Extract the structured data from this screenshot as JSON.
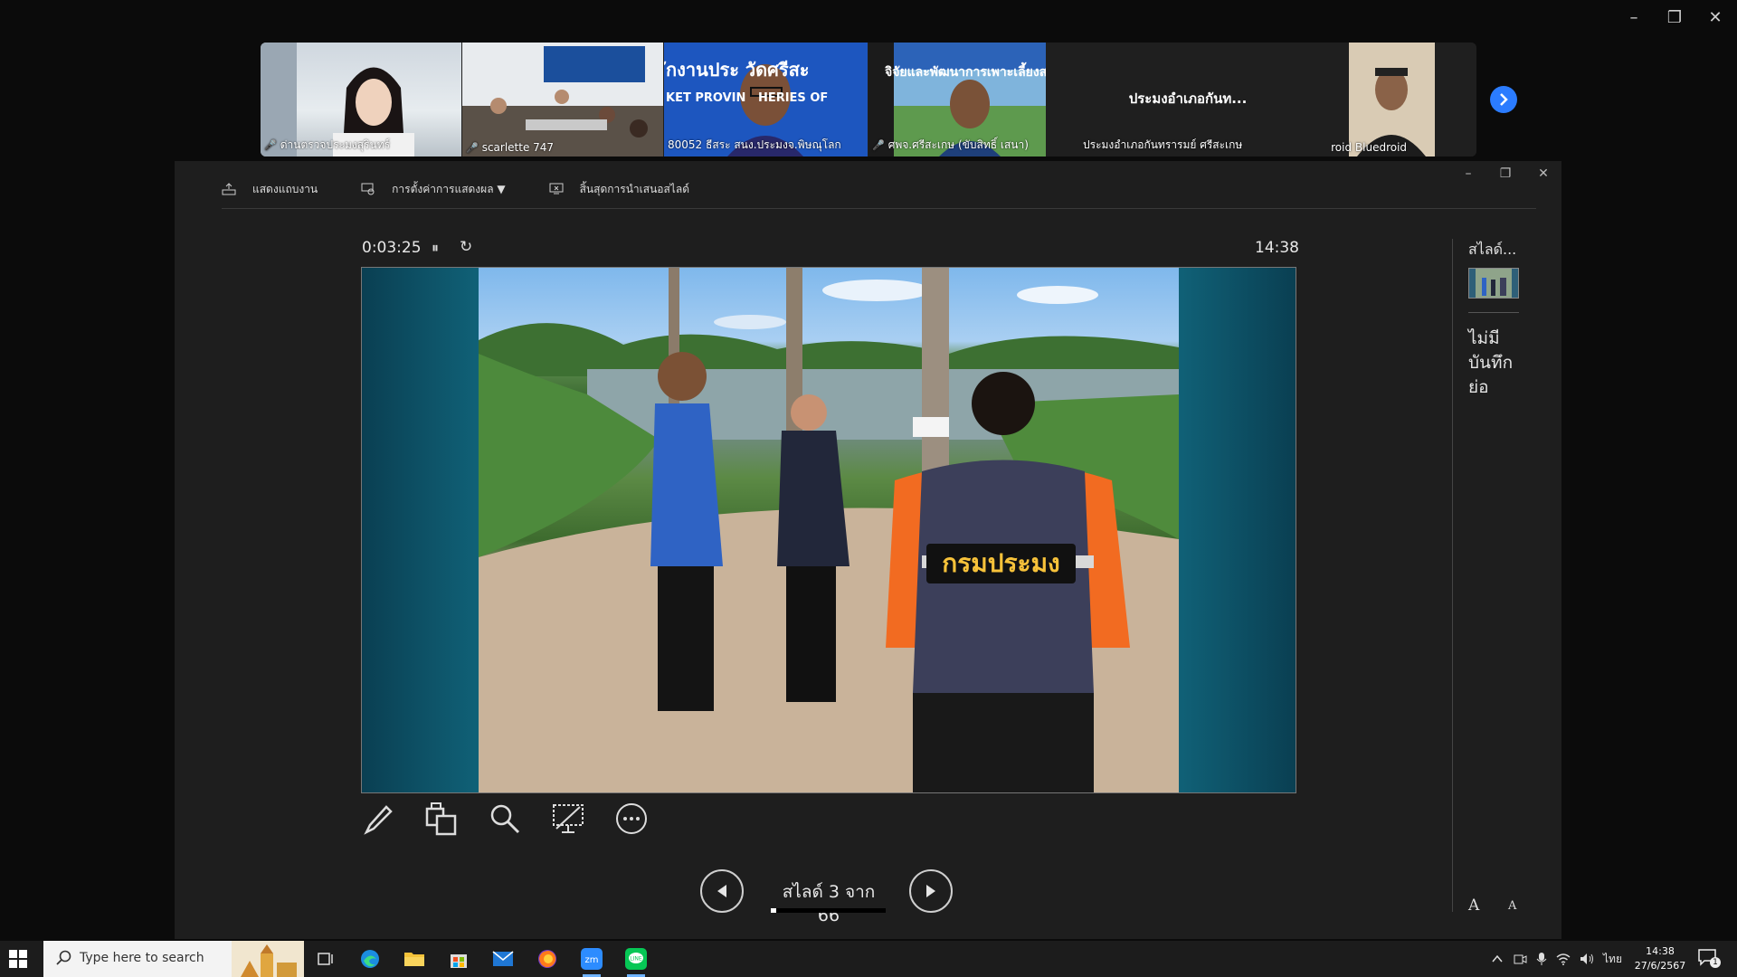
{
  "window": {
    "minimize": "–",
    "restore": "❐",
    "close": "✕"
  },
  "participants": [
    {
      "name": "ด่านตรวจประมงสุรินทร์",
      "muted": true
    },
    {
      "name": "scarlette 747",
      "muted": true
    },
    {
      "name": "80052 ธีสระ สนง.ประมงจ.พิษณุโลก",
      "muted": false,
      "active": true,
      "banner": "ักงานประ วัดศรีสะ",
      "banner2": "KET PROVIN   HERIES OF"
    },
    {
      "name": "ศพจ.ศรีสะเกษ (ขับสิทธิ์ เสนา)",
      "muted": true,
      "banner": "จิจัยและพัฒนาการเพาะเลี้ยงส"
    },
    {
      "name": "ประมงอำเภอกันทรารมย์ ศรีสะเกษ",
      "muted": false,
      "title": "ประมงอำเภอกันท..."
    },
    {
      "name": "Android Bluedroid",
      "muted": true
    }
  ],
  "presenter": {
    "toolbar": [
      {
        "label": "แสดงแถบงาน",
        "icon": "taskbar-icon"
      },
      {
        "label": "การตั้งค่าการแสดงผล ▼",
        "icon": "display-settings-icon"
      },
      {
        "label": "สิ้นสุดการนำเสนอสไลด์",
        "icon": "end-slideshow-icon"
      }
    ],
    "elapsed": "0:03:25",
    "pause": "⏸",
    "restart": "↻",
    "clock": "14:38",
    "slide_vest_text": "กรมประมง",
    "slide_counter": "สไลด์ 3 จาก 66",
    "progress": {
      "current": 3,
      "total": 66
    },
    "notes_header": "สไลด์...",
    "no_notes": "ไม่มีบันทึกย่อ",
    "font_up": "A",
    "font_down": "A"
  },
  "taskbar": {
    "search_placeholder": "Type here to search",
    "tray_lang": "ไทย",
    "time": "14:38",
    "date": "27/6/2567",
    "notification_count": "1"
  },
  "colors": {
    "accent": "#2b7cff",
    "active_speaker": "#29d37a",
    "muted": "#e0443e"
  }
}
